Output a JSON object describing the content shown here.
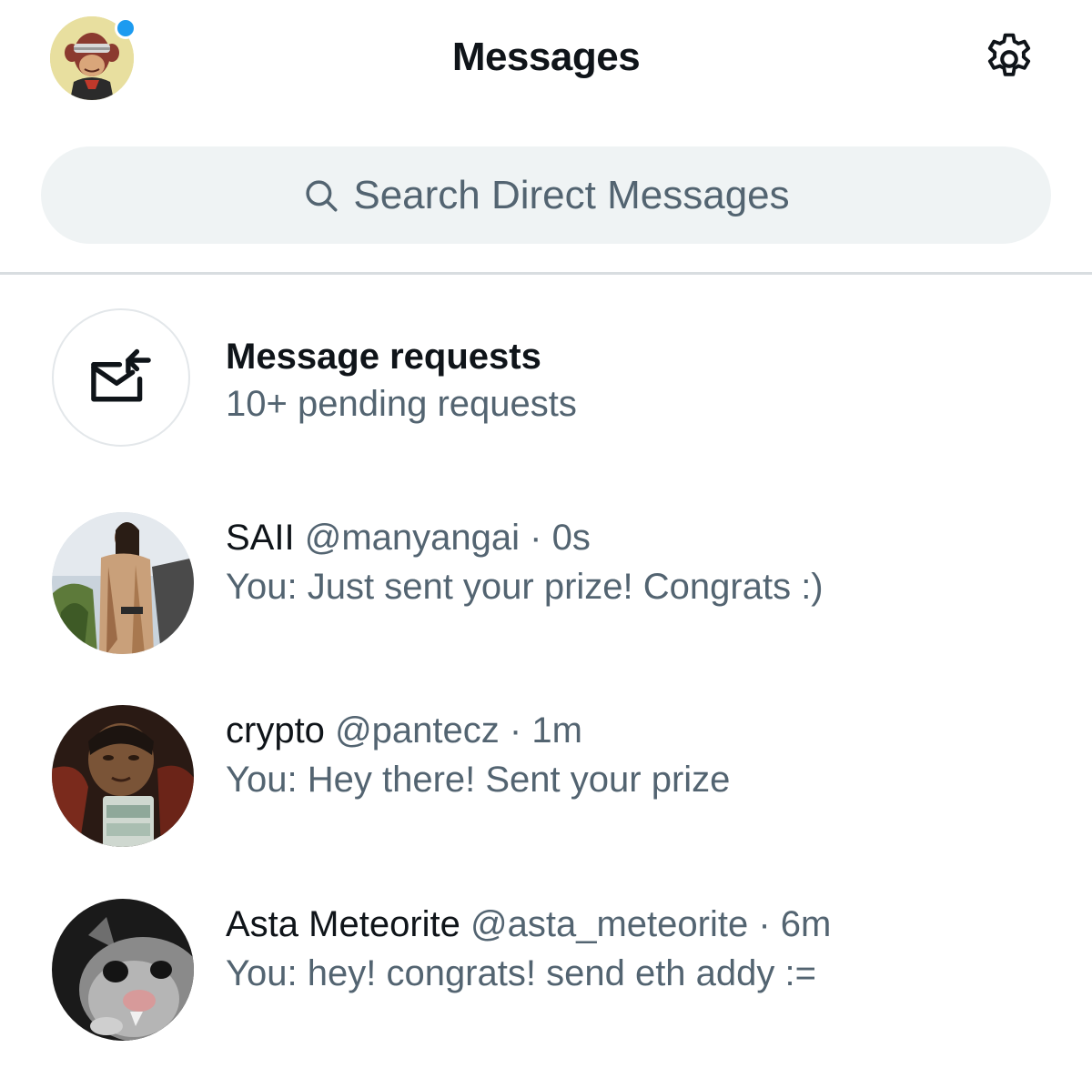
{
  "header": {
    "title": "Messages",
    "avatar_icon": "ape-avatar-icon",
    "settings_icon": "gear-icon"
  },
  "search": {
    "placeholder": "Search Direct Messages",
    "icon": "search-icon"
  },
  "requests": {
    "title": "Message requests",
    "subtitle": "10+ pending requests",
    "icon": "envelope-arrow-icon"
  },
  "conversations": [
    {
      "name": "SAII",
      "handle": "@manyangai",
      "time": "0s",
      "preview": "You: Just sent your prize! Congrats :)"
    },
    {
      "name": "crypto",
      "handle": "@pantecz",
      "time": "1m",
      "preview": "You: Hey there! Sent your prize"
    },
    {
      "name": "Asta Meteorite",
      "handle": "@asta_meteorite",
      "time": "6m",
      "preview": "You: hey! congrats! send eth addy :="
    }
  ],
  "colors": {
    "accent": "#1d9bf0",
    "text_primary": "#0f1419",
    "text_secondary": "#536471",
    "search_bg": "#eff3f4"
  }
}
